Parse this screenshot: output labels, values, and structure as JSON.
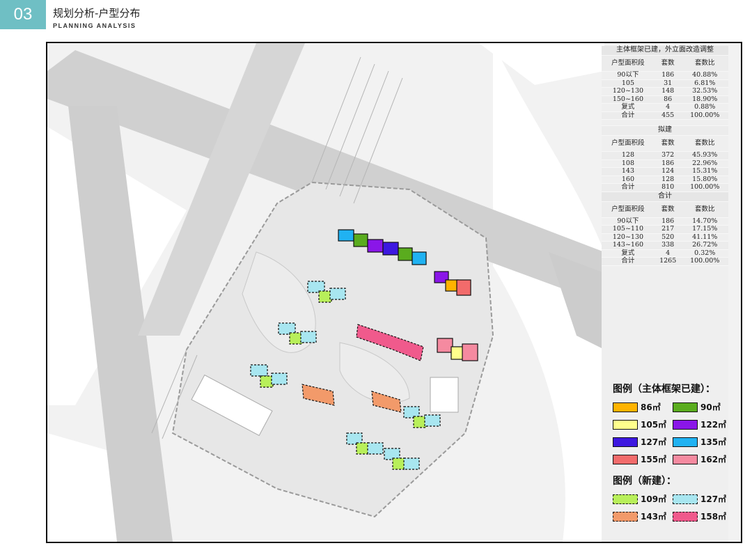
{
  "header": {
    "number": "03",
    "title": "规划分析-户型分布",
    "subtitle": "PLANNING ANALYSIS"
  },
  "stats": {
    "existing": {
      "title": "主体框架已建，外立面改造调整",
      "headers": [
        "户型面积段",
        "套数",
        "套数比"
      ],
      "rows": [
        [
          "90以下",
          "186",
          "40.88%"
        ],
        [
          "105",
          "31",
          "6.81%"
        ],
        [
          "120~130",
          "148",
          "32.53%"
        ],
        [
          "150~160",
          "86",
          "18.90%"
        ],
        [
          "复式",
          "4",
          "0.88%"
        ],
        [
          "合计",
          "455",
          "100.00%"
        ]
      ]
    },
    "planned": {
      "title": "拟建",
      "headers": [
        "户型面积段",
        "套数",
        "套数比"
      ],
      "rows": [
        [
          "128",
          "372",
          "45.93%"
        ],
        [
          "108",
          "186",
          "22.96%"
        ],
        [
          "143",
          "124",
          "15.31%"
        ],
        [
          "160",
          "128",
          "15.80%"
        ],
        [
          "合计",
          "810",
          "100.00%"
        ]
      ]
    },
    "total": {
      "title": "合计",
      "headers": [
        "户型面积段",
        "套数",
        "套数比"
      ],
      "rows": [
        [
          "90以下",
          "186",
          "14.70%"
        ],
        [
          "105~110",
          "217",
          "17.15%"
        ],
        [
          "120~130",
          "520",
          "41.11%"
        ],
        [
          "143~160",
          "338",
          "26.72%"
        ],
        [
          "复式",
          "4",
          "0.32%"
        ],
        [
          "合计",
          "1265",
          "100.00%"
        ]
      ]
    }
  },
  "legend": {
    "existing_title": "图例（主体框架已建）：",
    "existing_items": [
      {
        "label": "86㎡",
        "color": "#ffb300"
      },
      {
        "label": "90㎡",
        "color": "#5aac1e"
      },
      {
        "label": "105㎡",
        "color": "#ffff8c"
      },
      {
        "label": "122㎡",
        "color": "#8a16e8"
      },
      {
        "label": "127㎡",
        "color": "#3d18e0"
      },
      {
        "label": "135㎡",
        "color": "#20b2f2"
      },
      {
        "label": "155㎡",
        "color": "#f26b6b"
      },
      {
        "label": "162㎡",
        "color": "#f58aa0"
      }
    ],
    "new_title": "图例（新建）：",
    "new_items": [
      {
        "label": "109㎡",
        "color": "#b8ef5a"
      },
      {
        "label": "127㎡",
        "color": "#a8e6f0"
      },
      {
        "label": "143㎡",
        "color": "#f29a6a"
      },
      {
        "label": "158㎡",
        "color": "#f05a8c"
      }
    ]
  }
}
